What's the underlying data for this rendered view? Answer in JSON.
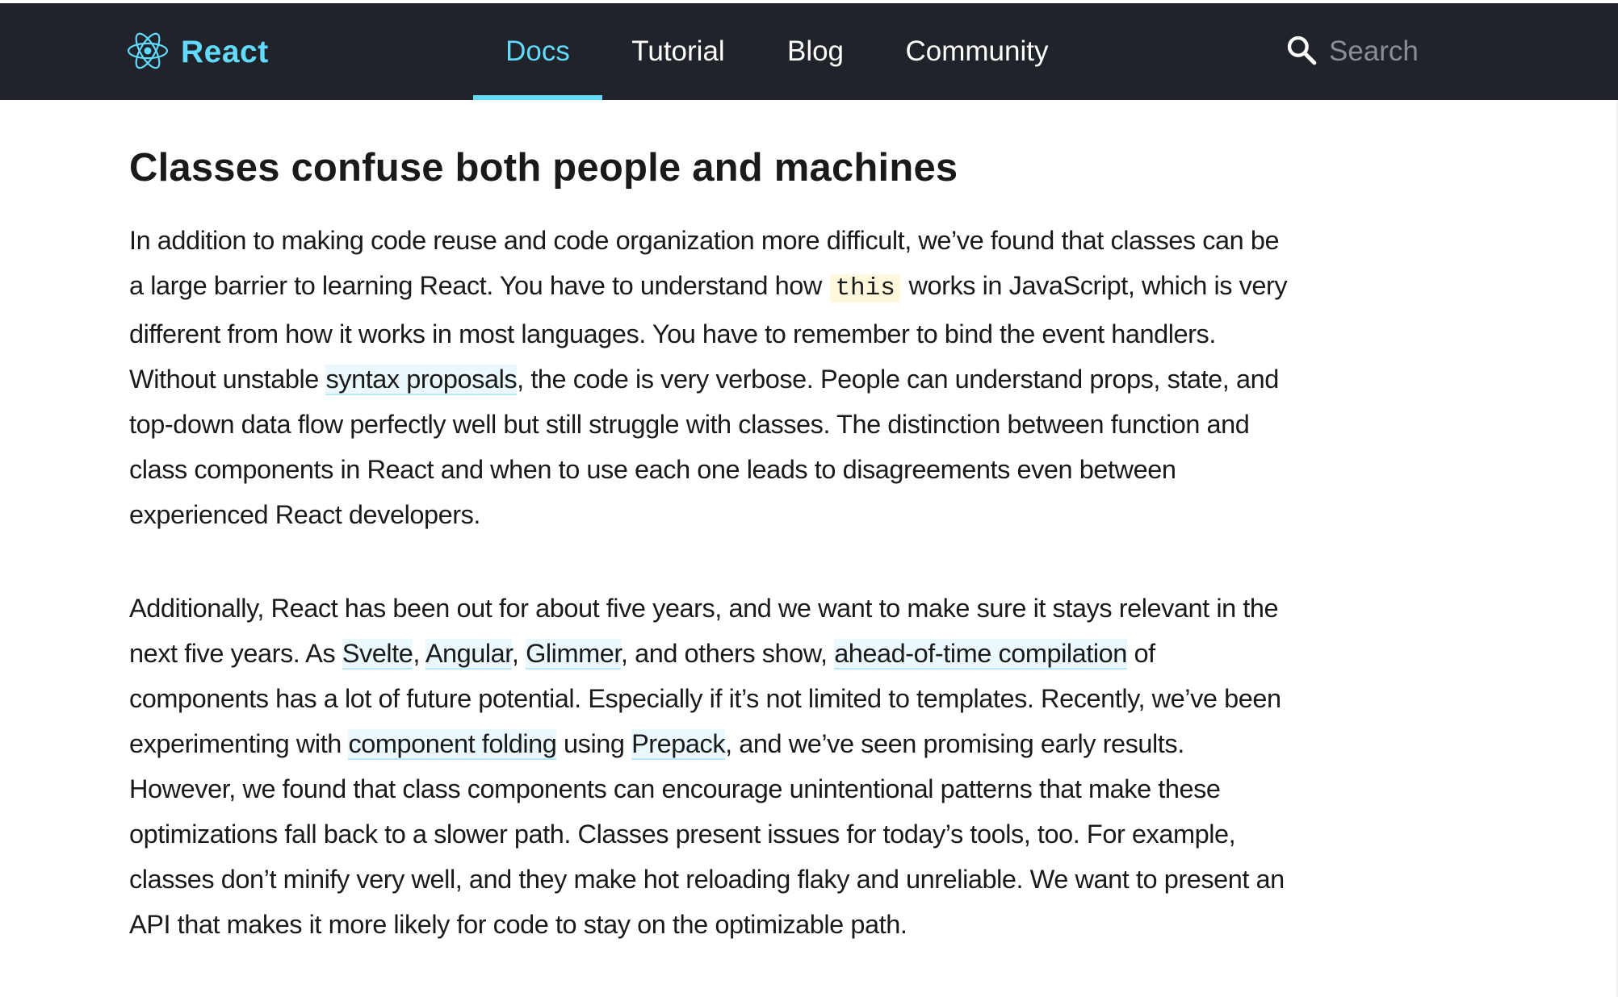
{
  "navbar": {
    "logo_text": "React",
    "items": [
      {
        "label": "Docs",
        "active": true
      },
      {
        "label": "Tutorial",
        "active": false
      },
      {
        "label": "Blog",
        "active": false
      },
      {
        "label": "Community",
        "active": false
      }
    ],
    "search_placeholder": "Search",
    "background": "#20232a",
    "accent": "#61dafb"
  },
  "article": {
    "heading": "Classes confuse both people and machines",
    "para1": {
      "t1": "In addition to making code reuse and code organization more difficult, we’ve found that classes can be a large barrier to learning React. You have to understand how",
      "code": "this",
      "t2": "works in JavaScript, which is very different from how it works in most languages. You have to remember to bind the event handlers. Without unstable",
      "link1": "syntax proposals",
      "t3": ", the code is very verbose. People can understand props, state, and top-down data flow perfectly well but still struggle with classes. The distinction between function and class components in React and when to use each one leads to disagreements even between experienced React developers."
    },
    "para2": {
      "t1": "Additionally, React has been out for about five years, and we want to make sure it stays relevant in the next five years. As",
      "link_svelte": "Svelte",
      "comma1": ",",
      "link_angular": "Angular",
      "comma2": ",",
      "link_glimmer": "Glimmer",
      "t2": ", and others show,",
      "link_aot": "ahead-of-time compilation",
      "t3": "of components has a lot of future potential. Especially if it’s not limited to templates. Recently, we’ve been experimenting with",
      "link_folding": "component folding",
      "t4": "using",
      "link_prepack": "Prepack",
      "t5": ", and we’ve seen promising early results. However, we found that class components can encourage unintentional patterns that make these optimizations fall back to a slower path. Classes present issues for today’s tools, too. For example, classes don’t minify very well, and they make hot reloading flaky and unreliable. We want to present an API that makes it more likely for code to stay on the optimizable path."
    }
  }
}
